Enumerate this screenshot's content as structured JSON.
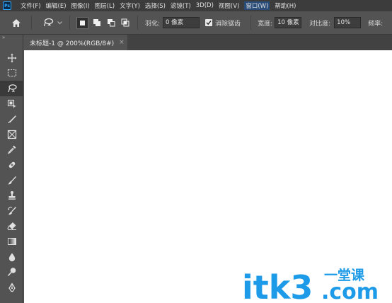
{
  "app": {
    "logo_text": "Ps"
  },
  "menu": [
    "文件(F)",
    "编辑(E)",
    "图像(I)",
    "图层(L)",
    "文字(Y)",
    "选择(S)",
    "滤镜(T)",
    "3D(D)",
    "视图(V)",
    "窗口(W)",
    "帮助(H)"
  ],
  "options": {
    "feather_label": "羽化:",
    "feather_value": "0 像素",
    "antialias_label": "消除锯齿",
    "antialias_checked": true,
    "width_label": "宽度:",
    "width_value": "10 像素",
    "contrast_label": "对比度:",
    "contrast_value": "10%",
    "frequency_label": "频率:"
  },
  "document": {
    "tab_title": "未标题-1 @ 200%(RGB/8#)",
    "close_symbol": "×"
  },
  "toolbar": {
    "collapse_symbol": "»",
    "tools": [
      "move",
      "rectangular-marquee",
      "magnetic-lasso",
      "object-selection",
      "slice",
      "frame",
      "eyedropper",
      "healing-brush",
      "brush",
      "clone-stamp",
      "history-brush",
      "eraser",
      "gradient",
      "blur",
      "dodge",
      "pen"
    ],
    "active_tool": "magnetic-lasso"
  },
  "watermark": {
    "text_main": "itk3",
    "text_suffix": ".com",
    "text_cn": "一堂课",
    "color": "#1e9be8"
  }
}
